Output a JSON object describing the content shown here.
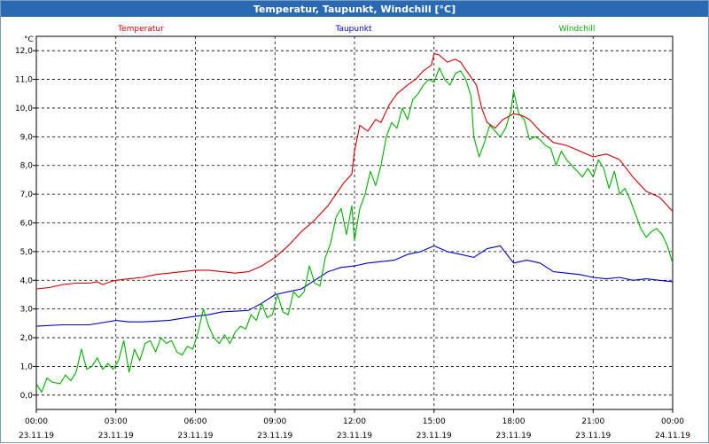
{
  "window": {
    "title": "Temperatur, Taupunkt, Windchill [°C]"
  },
  "chart_data": {
    "type": "line",
    "title": "Temperatur, Taupunkt, Windchill [°C]",
    "ylabel": "°C",
    "ylim": [
      -0.5,
      12.5
    ],
    "xlim": [
      0,
      24
    ],
    "grid": true,
    "y_ticks": [
      "0,0",
      "1,0",
      "2,0",
      "3,0",
      "4,0",
      "5,0",
      "6,0",
      "7,0",
      "8,0",
      "9,0",
      "10,0",
      "11,0",
      "12,0"
    ],
    "x_ticks": [
      {
        "x": 0,
        "time": "00:00",
        "date": "23.11.19"
      },
      {
        "x": 3,
        "time": "03:00",
        "date": "23.11.19"
      },
      {
        "x": 6,
        "time": "06:00",
        "date": "23.11.19"
      },
      {
        "x": 9,
        "time": "09:00",
        "date": "23.11.19"
      },
      {
        "x": 12,
        "time": "12:00",
        "date": "23.11.19"
      },
      {
        "x": 15,
        "time": "15:00",
        "date": "23.11.19"
      },
      {
        "x": 18,
        "time": "18:00",
        "date": "23.11.19"
      },
      {
        "x": 21,
        "time": "21:00",
        "date": "23.11.19"
      },
      {
        "x": 24,
        "time": "00:00",
        "date": "24.11.19"
      }
    ],
    "series": [
      {
        "name": "Temperatur",
        "color": "#d00000",
        "points": [
          [
            0,
            3.7
          ],
          [
            0.5,
            3.75
          ],
          [
            1,
            3.85
          ],
          [
            1.5,
            3.9
          ],
          [
            2,
            3.9
          ],
          [
            2.3,
            3.95
          ],
          [
            2.5,
            3.85
          ],
          [
            2.8,
            3.95
          ],
          [
            3,
            4.0
          ],
          [
            3.5,
            4.05
          ],
          [
            4,
            4.1
          ],
          [
            4.5,
            4.2
          ],
          [
            5,
            4.25
          ],
          [
            5.5,
            4.3
          ],
          [
            6,
            4.35
          ],
          [
            6.5,
            4.35
          ],
          [
            7,
            4.3
          ],
          [
            7.5,
            4.25
          ],
          [
            8,
            4.3
          ],
          [
            8.5,
            4.5
          ],
          [
            9,
            4.8
          ],
          [
            9.5,
            5.2
          ],
          [
            10,
            5.7
          ],
          [
            10.5,
            6.1
          ],
          [
            11,
            6.6
          ],
          [
            11.3,
            7.0
          ],
          [
            11.6,
            7.4
          ],
          [
            11.9,
            7.7
          ],
          [
            12.0,
            8.5
          ],
          [
            12.2,
            9.4
          ],
          [
            12.5,
            9.2
          ],
          [
            12.8,
            9.6
          ],
          [
            13,
            9.5
          ],
          [
            13.3,
            10.1
          ],
          [
            13.6,
            10.5
          ],
          [
            14,
            10.8
          ],
          [
            14.3,
            11.0
          ],
          [
            14.6,
            11.3
          ],
          [
            14.9,
            11.5
          ],
          [
            15,
            11.9
          ],
          [
            15.2,
            11.85
          ],
          [
            15.5,
            11.6
          ],
          [
            15.8,
            11.7
          ],
          [
            16,
            11.6
          ],
          [
            16.3,
            11.2
          ],
          [
            16.6,
            10.8
          ],
          [
            16.8,
            10.0
          ],
          [
            17,
            9.5
          ],
          [
            17.3,
            9.3
          ],
          [
            17.6,
            9.6
          ],
          [
            18,
            9.8
          ],
          [
            18.3,
            9.75
          ],
          [
            18.6,
            9.6
          ],
          [
            19,
            9.2
          ],
          [
            19.5,
            8.8
          ],
          [
            20,
            8.7
          ],
          [
            20.5,
            8.5
          ],
          [
            21,
            8.3
          ],
          [
            21.5,
            8.4
          ],
          [
            22,
            8.2
          ],
          [
            22.5,
            7.6
          ],
          [
            23,
            7.1
          ],
          [
            23.5,
            6.9
          ],
          [
            24,
            6.4
          ]
        ]
      },
      {
        "name": "Taupunkt",
        "color": "#0000c8",
        "points": [
          [
            0,
            2.4
          ],
          [
            1,
            2.45
          ],
          [
            2,
            2.45
          ],
          [
            3,
            2.6
          ],
          [
            3.5,
            2.55
          ],
          [
            4,
            2.55
          ],
          [
            5,
            2.6
          ],
          [
            6,
            2.75
          ],
          [
            6.5,
            2.8
          ],
          [
            7,
            2.9
          ],
          [
            8,
            2.95
          ],
          [
            8.5,
            3.2
          ],
          [
            9,
            3.5
          ],
          [
            9.5,
            3.6
          ],
          [
            10,
            3.7
          ],
          [
            10.5,
            4.0
          ],
          [
            11,
            4.3
          ],
          [
            11.5,
            4.45
          ],
          [
            12,
            4.5
          ],
          [
            12.5,
            4.6
          ],
          [
            13,
            4.65
          ],
          [
            13.5,
            4.7
          ],
          [
            14,
            4.9
          ],
          [
            14.5,
            5.0
          ],
          [
            15,
            5.2
          ],
          [
            15.5,
            5.0
          ],
          [
            16,
            4.9
          ],
          [
            16.5,
            4.8
          ],
          [
            17,
            5.1
          ],
          [
            17.5,
            5.2
          ],
          [
            18,
            4.6
          ],
          [
            18.5,
            4.7
          ],
          [
            19,
            4.6
          ],
          [
            19.5,
            4.3
          ],
          [
            20,
            4.25
          ],
          [
            20.5,
            4.2
          ],
          [
            21,
            4.1
          ],
          [
            21.5,
            4.05
          ],
          [
            22,
            4.1
          ],
          [
            22.5,
            4.0
          ],
          [
            23,
            4.05
          ],
          [
            23.5,
            4.0
          ],
          [
            24,
            3.95
          ]
        ]
      },
      {
        "name": "Windchill",
        "color": "#00b000",
        "points": [
          [
            0,
            0.4
          ],
          [
            0.2,
            0.1
          ],
          [
            0.4,
            0.6
          ],
          [
            0.6,
            0.45
          ],
          [
            0.9,
            0.4
          ],
          [
            1.1,
            0.7
          ],
          [
            1.3,
            0.5
          ],
          [
            1.5,
            0.8
          ],
          [
            1.7,
            1.6
          ],
          [
            1.9,
            0.9
          ],
          [
            2.1,
            1.0
          ],
          [
            2.3,
            1.3
          ],
          [
            2.5,
            0.9
          ],
          [
            2.7,
            1.1
          ],
          [
            2.9,
            0.9
          ],
          [
            3.1,
            1.2
          ],
          [
            3.3,
            1.9
          ],
          [
            3.5,
            0.8
          ],
          [
            3.7,
            1.6
          ],
          [
            3.9,
            1.2
          ],
          [
            4.1,
            1.8
          ],
          [
            4.3,
            1.9
          ],
          [
            4.5,
            1.5
          ],
          [
            4.7,
            2.0
          ],
          [
            4.9,
            1.8
          ],
          [
            5.1,
            1.9
          ],
          [
            5.3,
            1.5
          ],
          [
            5.5,
            1.4
          ],
          [
            5.7,
            1.7
          ],
          [
            5.9,
            1.6
          ],
          [
            6.1,
            2.2
          ],
          [
            6.3,
            3.0
          ],
          [
            6.5,
            2.4
          ],
          [
            6.7,
            2.0
          ],
          [
            6.9,
            1.8
          ],
          [
            7.1,
            2.1
          ],
          [
            7.3,
            1.8
          ],
          [
            7.5,
            2.2
          ],
          [
            7.7,
            2.4
          ],
          [
            7.9,
            2.3
          ],
          [
            8.1,
            2.8
          ],
          [
            8.3,
            2.6
          ],
          [
            8.5,
            3.2
          ],
          [
            8.7,
            2.7
          ],
          [
            8.9,
            2.8
          ],
          [
            9.1,
            3.5
          ],
          [
            9.3,
            2.9
          ],
          [
            9.5,
            2.8
          ],
          [
            9.7,
            3.6
          ],
          [
            9.9,
            3.4
          ],
          [
            10.1,
            3.6
          ],
          [
            10.3,
            4.5
          ],
          [
            10.5,
            3.9
          ],
          [
            10.7,
            3.8
          ],
          [
            10.9,
            4.8
          ],
          [
            11.1,
            5.3
          ],
          [
            11.3,
            6.2
          ],
          [
            11.5,
            6.5
          ],
          [
            11.7,
            5.6
          ],
          [
            11.9,
            6.6
          ],
          [
            12.0,
            5.4
          ],
          [
            12.2,
            6.5
          ],
          [
            12.4,
            7.0
          ],
          [
            12.6,
            7.8
          ],
          [
            12.8,
            7.3
          ],
          [
            13.0,
            8.0
          ],
          [
            13.2,
            9.0
          ],
          [
            13.4,
            9.5
          ],
          [
            13.6,
            9.3
          ],
          [
            13.8,
            10.0
          ],
          [
            14.0,
            9.6
          ],
          [
            14.2,
            10.3
          ],
          [
            14.4,
            10.5
          ],
          [
            14.6,
            10.8
          ],
          [
            14.8,
            11.0
          ],
          [
            15.0,
            10.9
          ],
          [
            15.2,
            11.4
          ],
          [
            15.4,
            11.0
          ],
          [
            15.6,
            10.8
          ],
          [
            15.8,
            11.2
          ],
          [
            16.0,
            11.3
          ],
          [
            16.2,
            11.0
          ],
          [
            16.4,
            10.4
          ],
          [
            16.5,
            9.0
          ],
          [
            16.7,
            8.3
          ],
          [
            16.9,
            8.8
          ],
          [
            17.1,
            9.4
          ],
          [
            17.3,
            9.2
          ],
          [
            17.5,
            9.0
          ],
          [
            17.7,
            9.3
          ],
          [
            17.9,
            9.9
          ],
          [
            18.0,
            10.6
          ],
          [
            18.2,
            9.8
          ],
          [
            18.4,
            9.6
          ],
          [
            18.6,
            8.9
          ],
          [
            18.8,
            9.0
          ],
          [
            19.0,
            8.9
          ],
          [
            19.2,
            8.7
          ],
          [
            19.4,
            8.6
          ],
          [
            19.6,
            8.0
          ],
          [
            19.8,
            8.5
          ],
          [
            20.0,
            8.2
          ],
          [
            20.2,
            8.0
          ],
          [
            20.4,
            7.8
          ],
          [
            20.6,
            7.6
          ],
          [
            20.8,
            7.9
          ],
          [
            21.0,
            7.6
          ],
          [
            21.2,
            8.2
          ],
          [
            21.4,
            7.9
          ],
          [
            21.6,
            7.2
          ],
          [
            21.8,
            7.8
          ],
          [
            22.0,
            7.0
          ],
          [
            22.2,
            7.2
          ],
          [
            22.4,
            6.8
          ],
          [
            22.6,
            6.3
          ],
          [
            22.8,
            5.8
          ],
          [
            23.0,
            5.5
          ],
          [
            23.2,
            5.7
          ],
          [
            23.4,
            5.8
          ],
          [
            23.6,
            5.6
          ],
          [
            23.8,
            5.2
          ],
          [
            24.0,
            4.6
          ]
        ]
      }
    ]
  }
}
